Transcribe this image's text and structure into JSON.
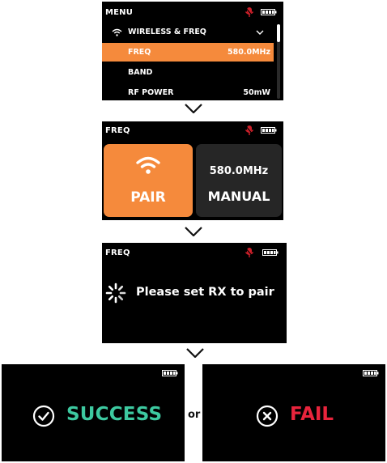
{
  "step1": {
    "title": "MENU",
    "section_label": "WIRELESS & FREQ",
    "items": [
      {
        "label": "FREQ",
        "value": "580.0MHz",
        "selected": true
      },
      {
        "label": "BAND",
        "value": ""
      },
      {
        "label": "RF POWER",
        "value": "50mW"
      }
    ]
  },
  "step2": {
    "title": "FREQ",
    "pair_label": "PAIR",
    "manual_freq": "580.0MHz",
    "manual_label": "MANUAL"
  },
  "step3": {
    "title": "FREQ",
    "message": "Please set RX to pair"
  },
  "result": {
    "success_label": "SUCCESS",
    "or_label": "or",
    "fail_label": "FAIL"
  },
  "colors": {
    "accent": "#f58a3c",
    "mic_red": "#d0202a",
    "success": "#3dc9a0",
    "fail": "#e8243c",
    "card_dark": "#262626"
  },
  "icons": [
    "wifi-icon",
    "chevron-down-icon",
    "mic-muted-icon",
    "battery-icon",
    "spinner-icon",
    "check-circle-icon",
    "x-circle-icon"
  ]
}
